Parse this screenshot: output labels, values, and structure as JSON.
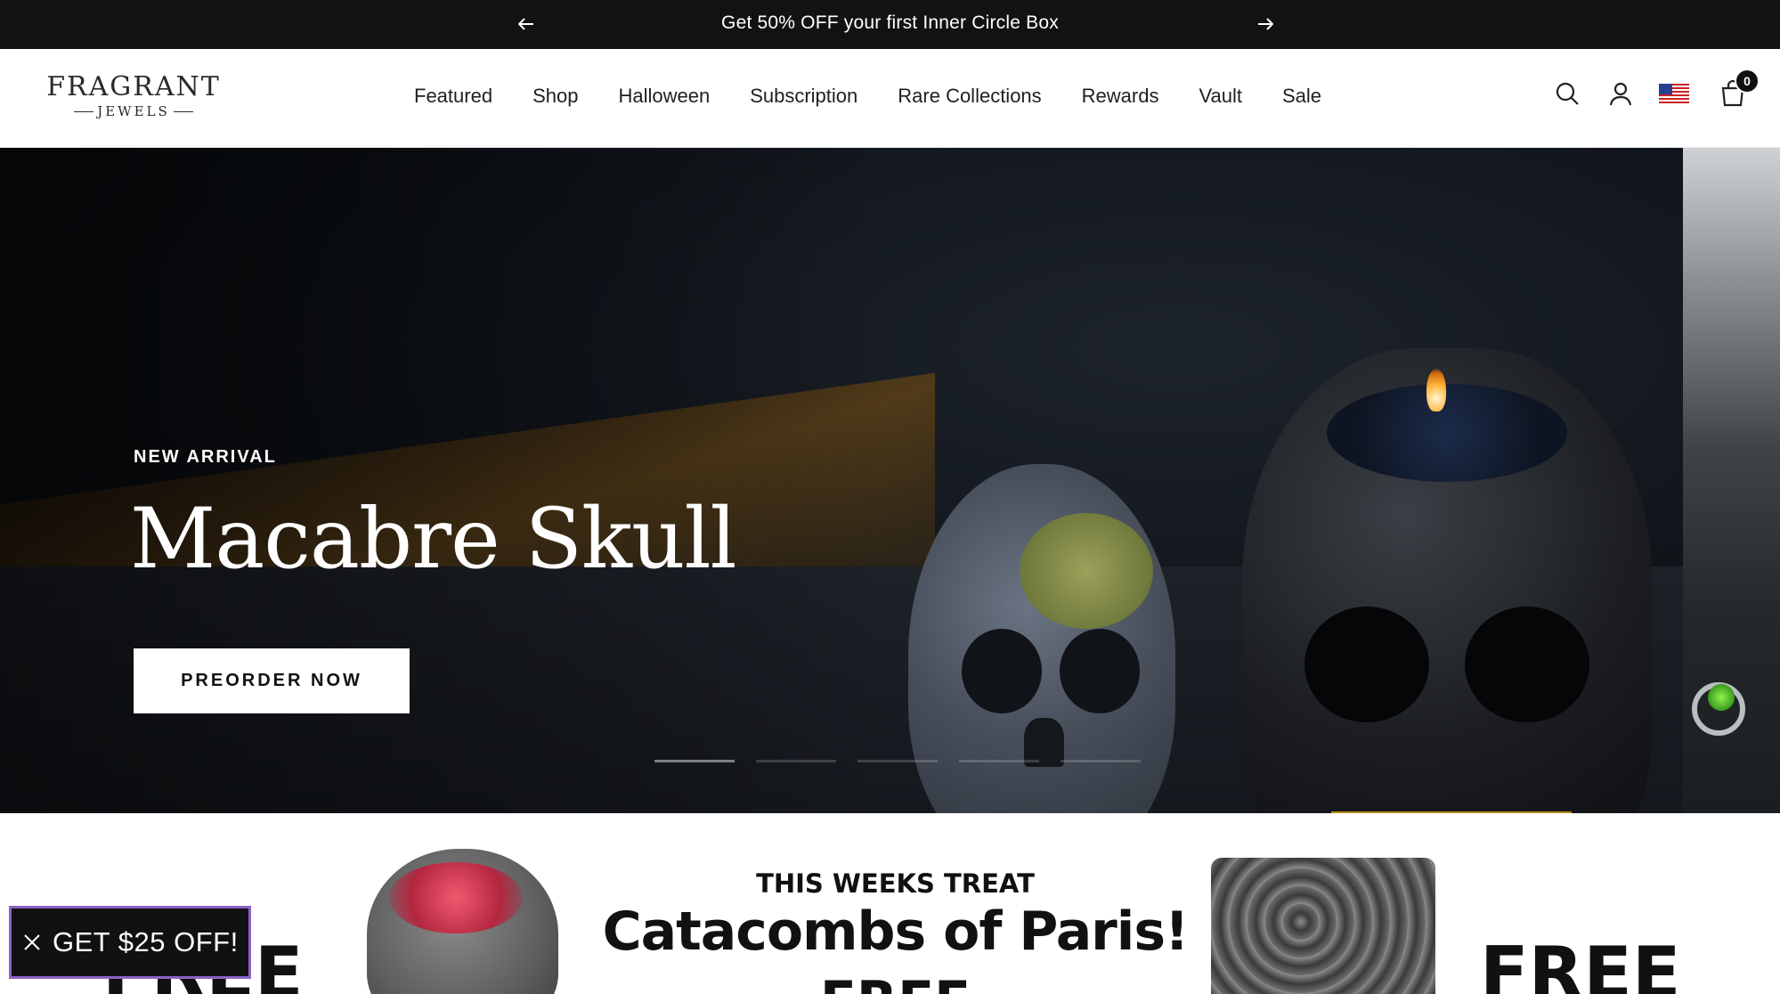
{
  "announcement": {
    "message": "Get 50% OFF your first Inner Circle Box",
    "prev_icon": "arrow-left-icon",
    "next_icon": "arrow-right-icon"
  },
  "header": {
    "logo_line1": "FRAGRANT",
    "logo_line2": "JEWELS",
    "nav": [
      "Featured",
      "Shop",
      "Halloween",
      "Subscription",
      "Rare Collections",
      "Rewards",
      "Vault",
      "Sale"
    ],
    "icons": [
      "search-icon",
      "account-icon",
      "us-flag-icon",
      "cart-icon"
    ],
    "cart_count": "0"
  },
  "hero": {
    "eyebrow": "NEW ARRIVAL",
    "headline": "Macabre Skull",
    "cta": "PREORDER NOW",
    "slides_total": 5,
    "active_slide": 1
  },
  "banner": {
    "left_word": "FREE",
    "right_word": "FREE",
    "subtitle": "THIS WEEKS TREAT",
    "title": "Catacombs of Paris!",
    "title_line2": "FREE"
  },
  "promo": {
    "label": "GET $25 OFF!",
    "close_icon": "close-icon"
  },
  "colors": {
    "announcement_bg": "#121212",
    "promo_border": "#8a63c8",
    "cta_bg": "#ffffff"
  }
}
